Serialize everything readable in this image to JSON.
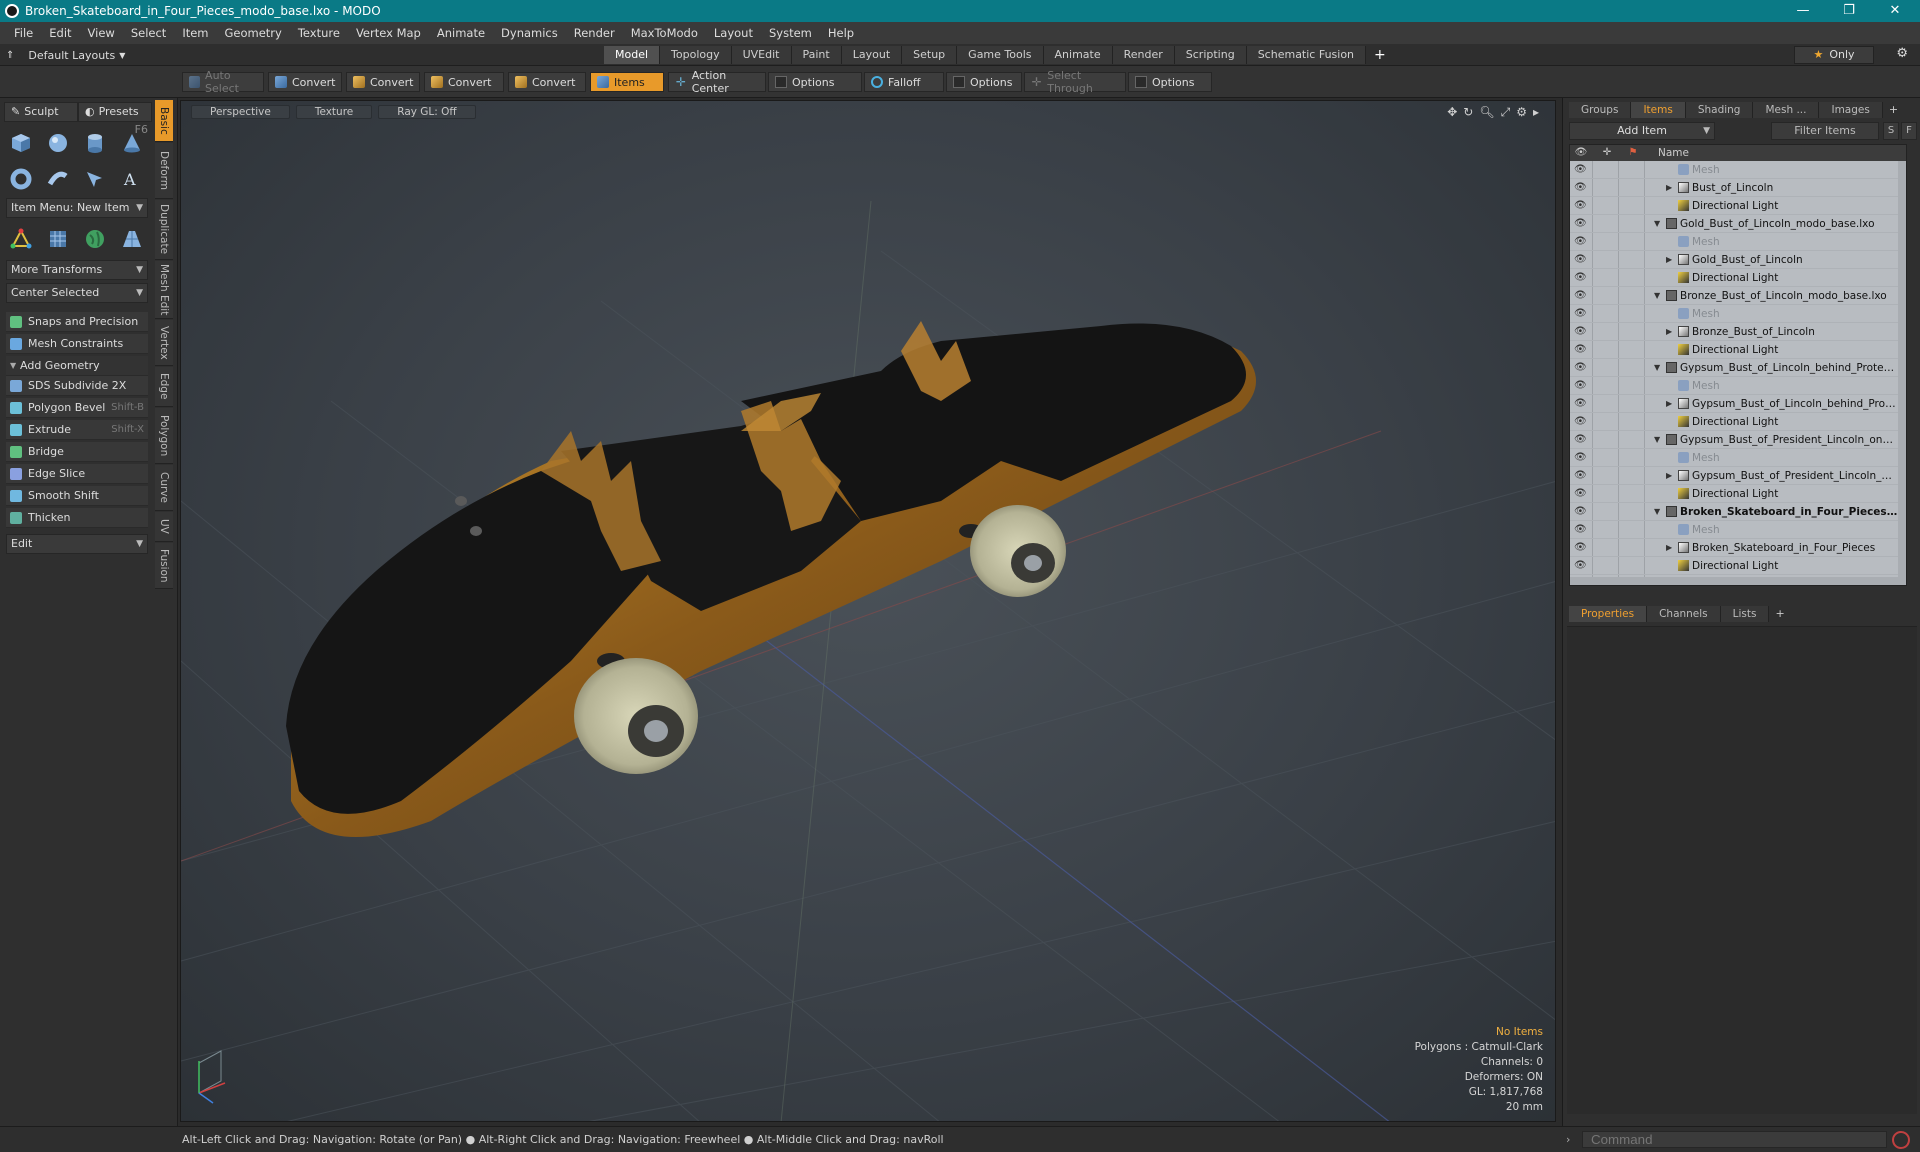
{
  "window": {
    "title": "Broken_Skateboard_in_Four_Pieces_modo_base.lxo - MODO",
    "controls": {
      "minimize": "—",
      "restore": "❐",
      "close": "✕"
    }
  },
  "menu": [
    "File",
    "Edit",
    "View",
    "Select",
    "Item",
    "Geometry",
    "Texture",
    "Vertex Map",
    "Animate",
    "Dynamics",
    "Render",
    "MaxToModo",
    "Layout",
    "System",
    "Help"
  ],
  "layout_bar": {
    "layout_selector": "Default Layouts",
    "tabs": [
      "Model",
      "Topology",
      "UVEdit",
      "Paint",
      "Layout",
      "Setup",
      "Game Tools",
      "Animate",
      "Render",
      "Scripting",
      "Schematic Fusion"
    ],
    "active_tab": "Model",
    "only_label": "Only"
  },
  "toolbar": {
    "auto_select": "Auto Select",
    "convert": "Convert",
    "items": "Items",
    "action_center": "Action Center",
    "options": "Options",
    "falloff": "Falloff",
    "select_through": "Select Through"
  },
  "left_panel": {
    "sculpt": "Sculpt",
    "presets": "Presets",
    "presets_shortcut": "F6",
    "item_menu": "Item Menu: New Item",
    "more_transforms": "More Transforms",
    "center_selected": "Center Selected",
    "snaps": "Snaps and Precision",
    "mesh_constraints": "Mesh Constraints",
    "add_geometry": "Add Geometry",
    "tools": [
      {
        "label": "SDS Subdivide 2X",
        "shortcut": "",
        "color": "#7aa8d8"
      },
      {
        "label": "Polygon Bevel",
        "shortcut": "Shift-B",
        "color": "#6cc0d8"
      },
      {
        "label": "Extrude",
        "shortcut": "Shift-X",
        "color": "#6cc0d8"
      },
      {
        "label": "Bridge",
        "shortcut": "",
        "color": "#60c080"
      },
      {
        "label": "Edge Slice",
        "shortcut": "",
        "color": "#8aa0e0"
      },
      {
        "label": "Smooth Shift",
        "shortcut": "",
        "color": "#70b8e0"
      },
      {
        "label": "Thicken",
        "shortcut": "",
        "color": "#60b0a0"
      }
    ],
    "edit": "Edit",
    "vertical_tabs": [
      "Basic",
      "Deform",
      "Duplicate",
      "Mesh Edit",
      "Vertex",
      "Edge",
      "Polygon",
      "Curve",
      "UV",
      "Fusion"
    ]
  },
  "viewport": {
    "view_mode": "Perspective",
    "shading": "Texture",
    "raygl": "Ray GL: Off",
    "info": {
      "selection": "No Items",
      "polygons": "Polygons : Catmull-Clark",
      "channels": "Channels: 0",
      "deformers": "Deformers: ON",
      "gl": "GL: 1,817,768",
      "scale": "20 mm"
    }
  },
  "right_panel": {
    "tabs": [
      "Groups",
      "Items",
      "Shading",
      "Mesh ...",
      "Images"
    ],
    "active_tab": "Items",
    "add_item": "Add Item",
    "filter_items": "Filter Items",
    "s_btn": "S",
    "f_btn": "F",
    "name_col": "Name",
    "rows": [
      {
        "label": "Mesh",
        "level": 2,
        "kind": "mesh",
        "dim": true,
        "expand": false
      },
      {
        "label": "Bust_of_Lincoln",
        "level": 2,
        "kind": "group",
        "dim": false,
        "expand": true
      },
      {
        "label": "Directional Light",
        "level": 2,
        "kind": "light",
        "dim": false,
        "expand": false
      },
      {
        "label": "Gold_Bust_of_Lincoln_modo_base.lxo",
        "level": 1,
        "kind": "scene",
        "dim": false,
        "expand": true,
        "open": true
      },
      {
        "label": "Mesh",
        "level": 2,
        "kind": "mesh",
        "dim": true,
        "expand": false
      },
      {
        "label": "Gold_Bust_of_Lincoln",
        "level": 2,
        "kind": "group",
        "dim": false,
        "expand": true
      },
      {
        "label": "Directional Light",
        "level": 2,
        "kind": "light",
        "dim": false,
        "expand": false
      },
      {
        "label": "Bronze_Bust_of_Lincoln_modo_base.lxo",
        "level": 1,
        "kind": "scene",
        "dim": false,
        "expand": true,
        "open": true
      },
      {
        "label": "Mesh",
        "level": 2,
        "kind": "mesh",
        "dim": true,
        "expand": false
      },
      {
        "label": "Bronze_Bust_of_Lincoln",
        "level": 2,
        "kind": "group",
        "dim": false,
        "expand": true
      },
      {
        "label": "Directional Light",
        "level": 2,
        "kind": "light",
        "dim": false,
        "expand": false
      },
      {
        "label": "Gypsum_Bust_of_Lincoln_behind_Protectiv...",
        "level": 1,
        "kind": "scene",
        "dim": false,
        "expand": true,
        "open": true
      },
      {
        "label": "Mesh",
        "level": 2,
        "kind": "mesh",
        "dim": true,
        "expand": false
      },
      {
        "label": "Gypsum_Bust_of_Lincoln_behind_Protec...",
        "level": 2,
        "kind": "group",
        "dim": false,
        "expand": true
      },
      {
        "label": "Directional Light",
        "level": 2,
        "kind": "light",
        "dim": false,
        "expand": false
      },
      {
        "label": "Gypsum_Bust_of_President_Lincoln_on_Pe...",
        "level": 1,
        "kind": "scene",
        "dim": false,
        "expand": true,
        "open": true
      },
      {
        "label": "Mesh",
        "level": 2,
        "kind": "mesh",
        "dim": true,
        "expand": false
      },
      {
        "label": "Gypsum_Bust_of_President_Lincoln_on_...",
        "level": 2,
        "kind": "group",
        "dim": false,
        "expand": true
      },
      {
        "label": "Directional Light",
        "level": 2,
        "kind": "light",
        "dim": false,
        "expand": false
      },
      {
        "label": "Broken_Skateboard_in_Four_Pieces...",
        "level": 1,
        "kind": "scene",
        "dim": false,
        "expand": true,
        "open": true,
        "bold": true
      },
      {
        "label": "Mesh",
        "level": 2,
        "kind": "mesh",
        "dim": true,
        "expand": false
      },
      {
        "label": "Broken_Skateboard_in_Four_Pieces",
        "level": 2,
        "kind": "group",
        "dim": false,
        "expand": true
      },
      {
        "label": "Directional Light",
        "level": 2,
        "kind": "light",
        "dim": false,
        "expand": false
      }
    ],
    "bottom_tabs": [
      "Properties",
      "Channels",
      "Lists"
    ],
    "bottom_active": "Properties"
  },
  "status": {
    "message": "Alt-Left Click and Drag: Navigation: Rotate (or Pan) ● Alt-Right Click and Drag: Navigation: Freewheel ● Alt-Middle Click and Drag: navRoll",
    "command_placeholder": "Command"
  },
  "colors": {
    "accent": "#e89a2a",
    "titlebar": "#0a7a86"
  }
}
